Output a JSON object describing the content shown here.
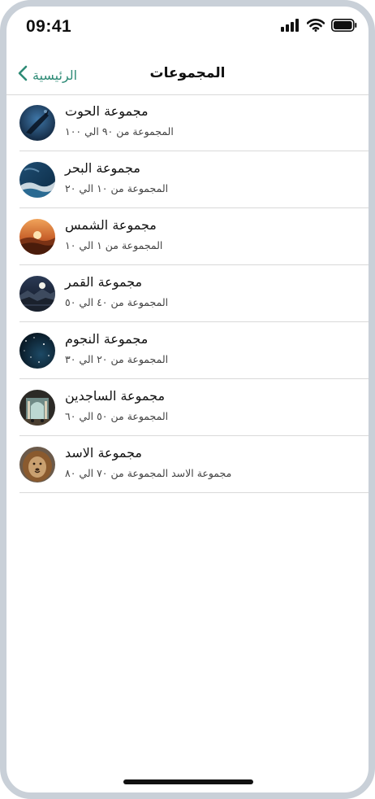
{
  "status_bar": {
    "time": "09:41",
    "icons": [
      "cellular-signal-icon",
      "wifi-icon",
      "battery-icon"
    ]
  },
  "nav": {
    "back_label": "الرئيسية",
    "title": "المجموعات"
  },
  "colors": {
    "accent": "#2e8b76",
    "separator": "#d9d9d9",
    "frame": "#c9d0d8"
  },
  "groups": [
    {
      "title": "مجموعة الحوت",
      "subtitle": "المجموعة من ٩٠ الي ١٠٠",
      "icon": "whale-photo"
    },
    {
      "title": "مجموعة البحر",
      "subtitle": "المجموعة من ١٠ الي ٢٠",
      "icon": "sea-photo"
    },
    {
      "title": "مجموعة الشمس",
      "subtitle": "المجموعة من ١ الي ١٠",
      "icon": "sun-photo"
    },
    {
      "title": "مجموعة القمر",
      "subtitle": "المجموعة من ٤٠ الي ٥٠",
      "icon": "moon-photo"
    },
    {
      "title": "مجموعة النجوم",
      "subtitle": "المجموعة من ٢٠ الي ٣٠",
      "icon": "stars-photo"
    },
    {
      "title": "مجموعة الساجدين",
      "subtitle": "المجموعة من ٥٠ الي ٦٠",
      "icon": "mosque-photo"
    },
    {
      "title": "مجموعة الاسد",
      "subtitle": "مجموعة الاسد المجموعة من ٧٠ الي ٨٠",
      "icon": "lion-photo"
    }
  ]
}
